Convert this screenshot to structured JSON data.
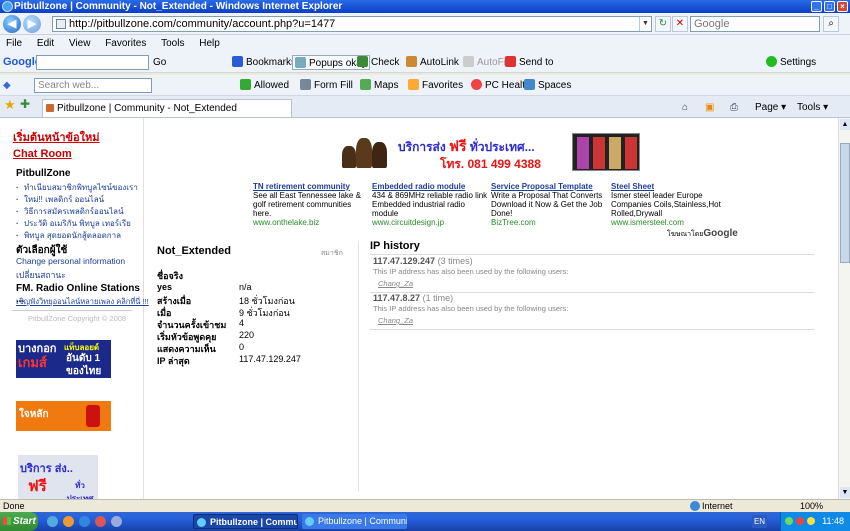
{
  "window": {
    "title": "Pitbullzone | Community - Not_Extended - Windows Internet Explorer"
  },
  "address": {
    "url": "http://pitbullzone.com/community/account.php?u=1477",
    "search_placeholder": "Google"
  },
  "menu": [
    "File",
    "Edit",
    "View",
    "Favorites",
    "Tools",
    "Help"
  ],
  "google_toolbar": {
    "brand": "Google",
    "go": "Go",
    "bookmarks": "Bookmarks",
    "popups": "Popups okay",
    "check": "Check",
    "autolink": "AutoLink",
    "autofill": "AutoFill",
    "sendto": "Send to",
    "settings": "Settings"
  },
  "search_toolbar": {
    "placeholder": "Search web...",
    "allowed": "Allowed",
    "formfill": "Form Fill",
    "maps": "Maps",
    "favorites": "Favorites",
    "pchealth": "PC Health",
    "spaces": "Spaces"
  },
  "tab": {
    "title": "Pitbullzone | Community - Not_Extended",
    "page": "Page",
    "tools": "Tools"
  },
  "sidebar": {
    "home_link": "เริ่มต้นหน้าข้อใหม่",
    "chat_link": "Chat Room",
    "section1": "PitbullZone",
    "items": [
      "ทำเนียบสมาชิกพิทบูลไซน์ของเรา",
      "ใหม่!! เพลดิกร์ ออนไลน์",
      "วิธีการสมัครเพลดิกร์ออนไลน์",
      "ประวัติ อเมริกัน พิทบูล เทอร์เรีย",
      "พิทบูล สุดยอดนักสู้ตลอดกาล"
    ],
    "section2": "ตัวเลือกผู้ใช้",
    "opt1": "Change personal information",
    "opt2": "เปลี่ยนสถานะ",
    "section3": "FM. Radio Online Stations ...",
    "radio_link": "เชิญฟังวิทยุออนไลน์หลายเพลง คลิกที่นี่ !!!",
    "copyright_brand": "PitbullZone",
    "copyright": "Copyright © 2008",
    "ad1": [
      "บางกอก",
      "เกมส์",
      "แท็บลอยด์",
      "อันดับ 1",
      "ของไทย"
    ],
    "ad2": "ใจหลัก",
    "ad3": [
      "บริการ ส่ง..",
      "ฟรี",
      "ทั่วประเทศ"
    ]
  },
  "banner": {
    "line1": "บริการส่ง",
    "free": "ฟรี",
    "line1b": "ทั่วประเทศ...",
    "phone": "โทร. 081 499 4388"
  },
  "ads": [
    {
      "title": "TN retirement community",
      "desc": "See all East Tennessee lake & golf retirement communities here.",
      "url": "www.onthelake.biz"
    },
    {
      "title": "Embedded radio module",
      "desc": "434 & 869MHz reliable radio link Embedded industrial radio module",
      "url": "www.circuitdesign.jp"
    },
    {
      "title": "Service Proposal Template",
      "desc": "Write a Proposal That Converts Download it Now & Get the Job Done!",
      "url": "BizTree.com"
    },
    {
      "title": "Steel Sheet",
      "desc": "Ismer steel leader Europe Companies Coils,Stainless,Hot Rolled,Drywall",
      "url": "www.ismersteel.com"
    }
  ],
  "ads_by": "โฆษณาโดย",
  "ads_brand": "Google",
  "profile": {
    "name": "Not_Extended",
    "rank": "สมาชิก",
    "section": "ชื่อจริง",
    "rows": [
      {
        "label": "yes",
        "value": "n/a"
      },
      {
        "label": "สร้างเมื่อ",
        "value": "18 ชั่วโมงก่อน"
      },
      {
        "label": "เมื่อ",
        "value": "9 ชั่วโมงก่อน"
      },
      {
        "label": "จำนวนครั้งเข้าชม",
        "value": "4"
      },
      {
        "label": "เริ่มหัวข้อพูดคุย",
        "value": "220"
      },
      {
        "label": "แสดงความเห็น",
        "value": "0"
      },
      {
        "label": "IP ล่าสุด",
        "value": "117.47.129.247"
      }
    ]
  },
  "ip_history": {
    "title": "IP history",
    "entries": [
      {
        "ip": "117.47.129.247",
        "times": "(3 times)",
        "note": "This IP address has also been used by the following users:",
        "user": "Chang_Za"
      },
      {
        "ip": "117.47.8.27",
        "times": "(1 time)",
        "note": "This IP address has also been used by the following users:",
        "user": "Chang_Za"
      }
    ]
  },
  "status": {
    "text": "Done",
    "zone": "Internet",
    "zoom": "100%"
  },
  "taskbar": {
    "start": "Start",
    "tasks": [
      "Pitbullzone | Commu...",
      "Pitbullzone | Community ..."
    ],
    "lang": "EN",
    "clock": "11:48"
  },
  "colors": {
    "link": "#1d3d9c",
    "red": "#cc0000",
    "green": "#2a8a2a",
    "title": "#0a3fc7"
  }
}
